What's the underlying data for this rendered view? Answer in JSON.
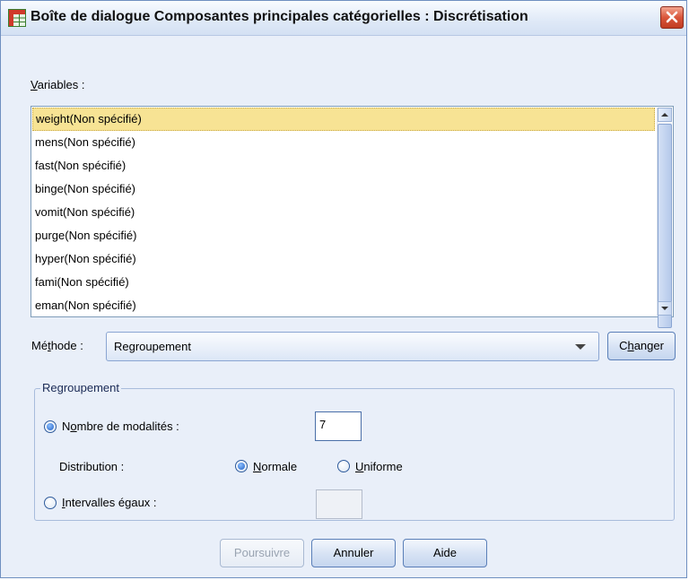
{
  "window": {
    "title": "Boîte de dialogue Composantes principales catégorielles : Discrétisation"
  },
  "icons": {
    "app": "spreadsheet-icon",
    "close": "close-icon",
    "scroll_up": "arrow-up-icon",
    "scroll_down": "arrow-down-icon",
    "dropdown": "chevron-down-icon"
  },
  "colors": {
    "selection": "#f7e394",
    "close_button": "#d9553a",
    "dialog_bg": "#e9eff9"
  },
  "variables": {
    "label_accel": "V",
    "label_rest": "ariables :",
    "items": [
      "weight(Non spécifié)",
      "mens(Non spécifié)",
      "fast(Non spécifié)",
      "binge(Non spécifié)",
      "vomit(Non spécifié)",
      "purge(Non spécifié)",
      "hyper(Non spécifié)",
      "fami(Non spécifié)",
      "eman(Non spécifié)"
    ],
    "selected_index": 0
  },
  "method": {
    "label_pre": "Mé",
    "label_accel": "t",
    "label_post": "hode :",
    "value": "Regroupement",
    "change_pre": "C",
    "change_accel": "h",
    "change_post": "anger"
  },
  "group": {
    "title": "Regroupement",
    "num_categories": {
      "label_pre": "N",
      "label_accel": "o",
      "label_post": "mbre de modalités :",
      "value": "7",
      "selected": true
    },
    "distribution": {
      "label": "Distribution :",
      "normal_accel": "N",
      "normal_rest": "ormale",
      "normal_selected": true,
      "uniform_accel": "U",
      "uniform_rest": "niforme",
      "uniform_selected": false
    },
    "equal_intervals": {
      "label_accel": "I",
      "label_rest": "ntervalles égaux :",
      "value": "",
      "selected": false
    }
  },
  "buttons": {
    "continue": "Poursuivre",
    "cancel": "Annuler",
    "help": "Aide"
  }
}
